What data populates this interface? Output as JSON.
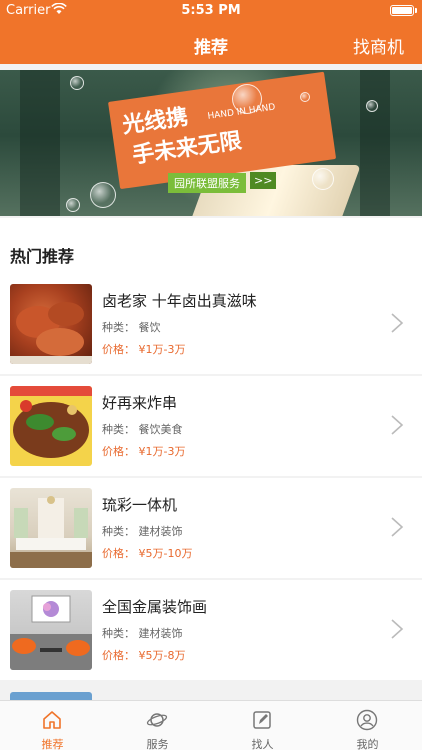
{
  "status_bar": {
    "carrier": "Carrier",
    "time": "5:53 PM"
  },
  "nav": {
    "title": "推荐",
    "right_label": "找商机"
  },
  "banner": {
    "slogan_line1": "光线携",
    "slogan_line2": "手未来无限",
    "hand_text": "HAND IN HAND",
    "tag": "园所联盟服务",
    "arrow": ">>"
  },
  "section": {
    "title": "热门推荐"
  },
  "items": [
    {
      "name": "卤老家 十年卤出真滋味",
      "category": "种类：  餐饮",
      "price": "价格：  ¥1万-3万",
      "image": "braised-pork-trotters"
    },
    {
      "name": "好再来炸串",
      "category": "种类：  餐饮美食",
      "price": "价格：  ¥1万-3万",
      "image": "fried-skewers"
    },
    {
      "name": "琉彩一体机",
      "category": "种类：  建材装饰",
      "price": "价格：  ¥5万-10万",
      "image": "living-room"
    },
    {
      "name": "全国金属装饰画",
      "category": "种类：  建材装饰",
      "price": "价格：  ¥5万-8万",
      "image": "wall-art-room"
    }
  ],
  "tabs": [
    {
      "label": "推荐",
      "icon": "home-icon",
      "active": true
    },
    {
      "label": "服务",
      "icon": "planet-icon",
      "active": false
    },
    {
      "label": "找人",
      "icon": "edit-icon",
      "active": false
    },
    {
      "label": "我的",
      "icon": "user-icon",
      "active": false
    }
  ],
  "colors": {
    "accent": "#f0742a",
    "price": "#e8692e"
  }
}
